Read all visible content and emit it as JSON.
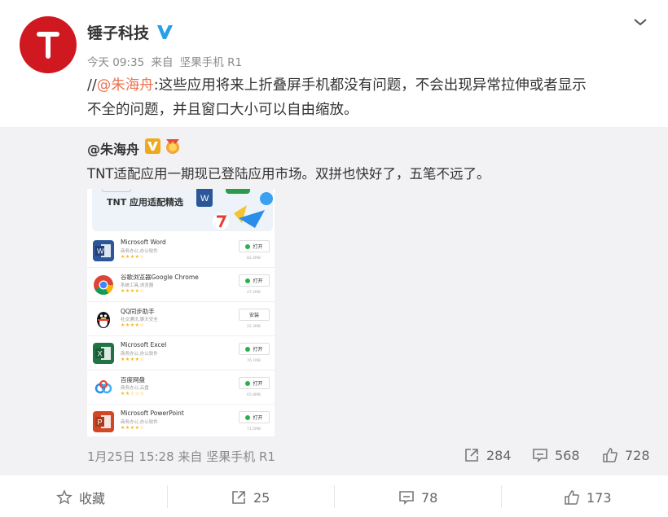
{
  "post": {
    "username": "锤子科技",
    "time": "今天 09:35",
    "source_prefix": "来自",
    "source": "坚果手机 R1",
    "text_prefix": "//",
    "mention": "@朱海舟",
    "text_line1": ":这些应用将来上折叠屏手机都没有问题，不会出现异常拉伸或者显示",
    "text_line2": "不全的问题，并且窗口大小可以自由缩放。"
  },
  "repost": {
    "username": "@朱海舟",
    "text": "TNT适配应用一期现已登陆应用市场。双拼也快好了，五笔不远了。",
    "screenshot": {
      "banner_title": "TNT 应用适配精选",
      "apps": [
        {
          "name": "Microsoft Word",
          "sub": "商务办公,办公软件",
          "stars": "★★★★☆",
          "button": "打开",
          "installed": true,
          "size": "82.4MB",
          "color": "#2b579a",
          "letter": "W"
        },
        {
          "name": "谷歌浏览器Google Chrome",
          "sub": "系统工具,浏览器",
          "stars": "★★★★☆",
          "button": "打开",
          "installed": true,
          "size": "47.2MB",
          "color": "#ffffff",
          "letter": ""
        },
        {
          "name": "QQ同步助手",
          "sub": "社交通讯,聊天安全",
          "stars": "★★★★☆",
          "button": "安装",
          "installed": false,
          "size": "22.3MB",
          "color": "#ffffff",
          "letter": ""
        },
        {
          "name": "Microsoft Excel",
          "sub": "商务办公,办公软件",
          "stars": "★★★★☆",
          "button": "打开",
          "installed": true,
          "size": "76.1MB",
          "color": "#217346",
          "letter": "X"
        },
        {
          "name": "百度网盘",
          "sub": "商务办公,云盘",
          "stars": "★★☆☆☆",
          "button": "打开",
          "installed": true,
          "size": "65.8MB",
          "color": "#ffffff",
          "letter": ""
        },
        {
          "name": "Microsoft PowerPoint",
          "sub": "商务办公,办公软件",
          "stars": "★★★★☆",
          "button": "打开",
          "installed": true,
          "size": "71.5MB",
          "color": "#d24726",
          "letter": "P"
        }
      ]
    },
    "time": "1月25日 15:28",
    "source_prefix": "来自",
    "source": "坚果手机 R1",
    "forward_count": "284",
    "comment_count": "568",
    "like_count": "728"
  },
  "actions": {
    "favorite_label": "收藏",
    "forward_count": "25",
    "comment_count": "78",
    "like_count": "173"
  },
  "colors": {
    "brand_red": "#d01820",
    "mention": "#eb7350",
    "verified_blue": "#27a0e9",
    "verified_gold": "#f0a81e"
  }
}
